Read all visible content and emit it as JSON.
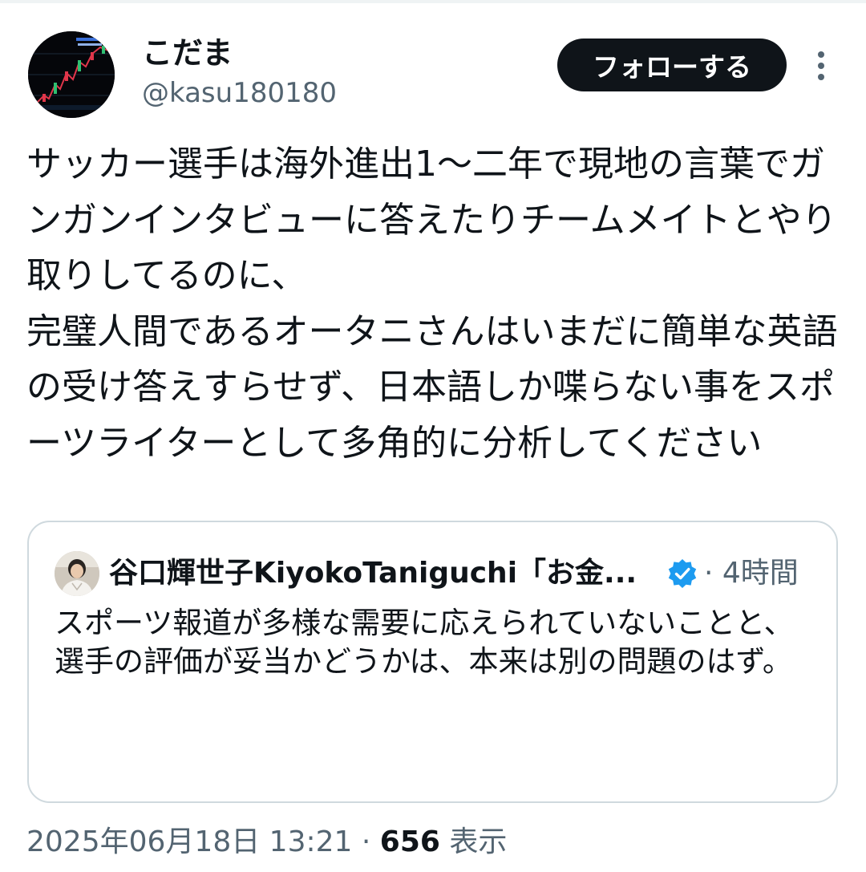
{
  "author": {
    "display_name": "こだま",
    "handle": "@kasu180180",
    "avatar_icon": "candlestick-chart-avatar"
  },
  "follow_button": {
    "label": "フォローする"
  },
  "more_menu": {
    "icon": "vertical-ellipsis-icon"
  },
  "tweet": {
    "text": "サッカー選手は海外進出1〜二年で現地の言葉でガンガンインタビューに答えたりチームメイトとやり取りしてるのに、\n完璧人間であるオータニさんはいまだに簡単な英語の受け答えすらせず、日本語しか喋らない事をスポーツライターとして多角的に分析してください"
  },
  "quoted_tweet": {
    "display_name": "谷口輝世子KiyokoTaniguchi「お金...",
    "verified": true,
    "separator": "·",
    "time_ago": "4時間",
    "text": "スポーツ報道が多様な需要に応えられていないことと、\n選手の評価が妥当かどうかは、本来は別の問題のはず。"
  },
  "footer": {
    "timestamp": "2025年06月18日 13:21",
    "separator": "·",
    "views_count": "656",
    "views_label": "表示"
  },
  "colors": {
    "text_primary": "#0f1419",
    "text_secondary": "#536471",
    "border": "#cfd9de",
    "verified_blue": "#1d9bf0",
    "button_bg": "#0f1419"
  }
}
